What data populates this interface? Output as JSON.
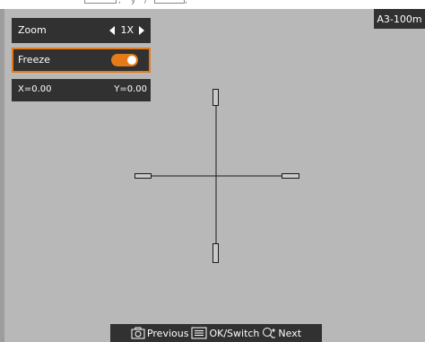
{
  "top_strip": {
    "fragments": [
      ",",
      "y",
      "/",
      ","
    ]
  },
  "zoom": {
    "label": "Zoom",
    "value": "1X",
    "icons": {
      "decrease": "triangle-left-icon",
      "increase": "triangle-right-icon"
    }
  },
  "freeze": {
    "label": "Freeze",
    "enabled": true,
    "accent_color": "#e47a18"
  },
  "coordinates": {
    "x_label": "X=0.00",
    "y_label": "Y=0.00"
  },
  "range_badge": "A3-100m",
  "bottom_bar": {
    "previous": {
      "icon": "camera-icon",
      "label": "Previous"
    },
    "switch": {
      "icon": "menu-icon",
      "label": "OK/Switch"
    },
    "next": {
      "icon": "zoom-plus-minus-icon",
      "label": "Next"
    }
  }
}
